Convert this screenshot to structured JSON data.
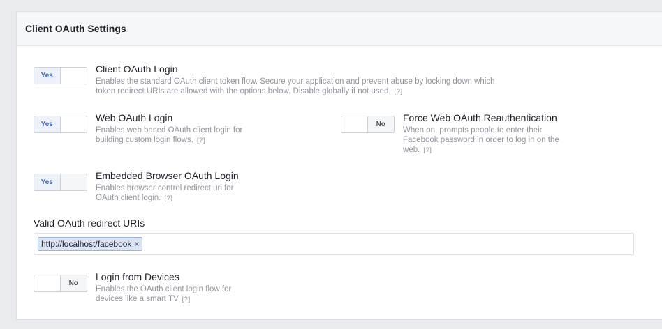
{
  "panel": {
    "title": "Client OAuth Settings"
  },
  "settings": {
    "client_oauth_login": {
      "toggle_label": "Yes",
      "title": "Client OAuth Login",
      "description": "Enables the standard OAuth client token flow. Secure your application and prevent abuse by locking down which token redirect URIs are allowed with the options below. Disable globally if not used.",
      "help": "[?]"
    },
    "web_oauth_login": {
      "toggle_label": "Yes",
      "title": "Web OAuth Login",
      "description": "Enables web based OAuth client login for building custom login flows.",
      "help": "[?]"
    },
    "force_web_oauth_reauth": {
      "toggle_label": "No",
      "title": "Force Web OAuth Reauthentication",
      "description": "When on, prompts people to enter their Facebook password in order to log in on the web.",
      "help": "[?]"
    },
    "embedded_browser_oauth_login": {
      "toggle_label": "Yes",
      "title": "Embedded Browser OAuth Login",
      "description": "Enables browser control redirect uri for OAuth client login.",
      "help": "[?]"
    },
    "login_from_devices": {
      "toggle_label": "No",
      "title": "Login from Devices",
      "description": "Enables the OAuth client login flow for devices like a smart TV",
      "help": "[?]"
    }
  },
  "redirect_uris": {
    "label": "Valid OAuth redirect URIs",
    "tokens": [
      "http://localhost/facebook"
    ],
    "remove_glyph": "×"
  },
  "colors": {
    "accent": "#4267b2",
    "toggle_on_bg": "#edf2fa",
    "token_bg": "#dbe4f3",
    "token_border": "#9cb4d8",
    "muted_text": "#90949c"
  }
}
